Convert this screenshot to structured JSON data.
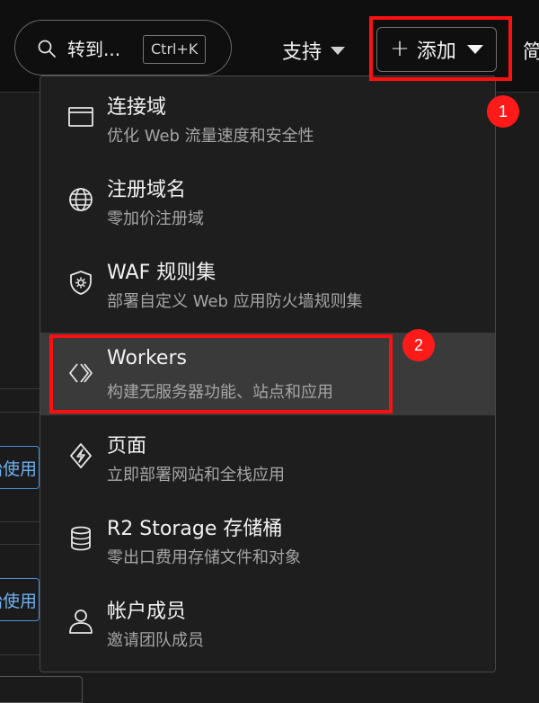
{
  "header": {
    "search": {
      "text": "转到...",
      "shortcut": "Ctrl+K"
    },
    "support_label": "支持",
    "add_label": "添加",
    "cut_off_label": "简"
  },
  "background": {
    "row_button_1": "开始使用",
    "row_button_2": "开始使用"
  },
  "add_menu": {
    "items": [
      {
        "icon": "browser-window-icon",
        "title": "连接域",
        "desc": "优化 Web 流量速度和安全性"
      },
      {
        "icon": "globe-icon",
        "title": "注册域名",
        "desc": "零加价注册域"
      },
      {
        "icon": "shield-gear-icon",
        "title": "WAF 规则集",
        "desc": "部署自定义 Web 应用防火墙规则集"
      },
      {
        "icon": "code-brackets-icon",
        "title": "Workers",
        "desc": "构建无服务器功能、站点和应用",
        "highlighted": true
      },
      {
        "icon": "lightning-bolt-icon",
        "title": "页面",
        "desc": "立即部署网站和全栈应用"
      },
      {
        "icon": "database-icon",
        "title": "R2 Storage 存储桶",
        "desc": "零出口费用存储文件和对象"
      },
      {
        "icon": "person-icon",
        "title": "帐户成员",
        "desc": "邀请团队成员"
      }
    ]
  },
  "annotations": {
    "step_1": "1",
    "step_2": "2",
    "color": "#ff1010"
  }
}
